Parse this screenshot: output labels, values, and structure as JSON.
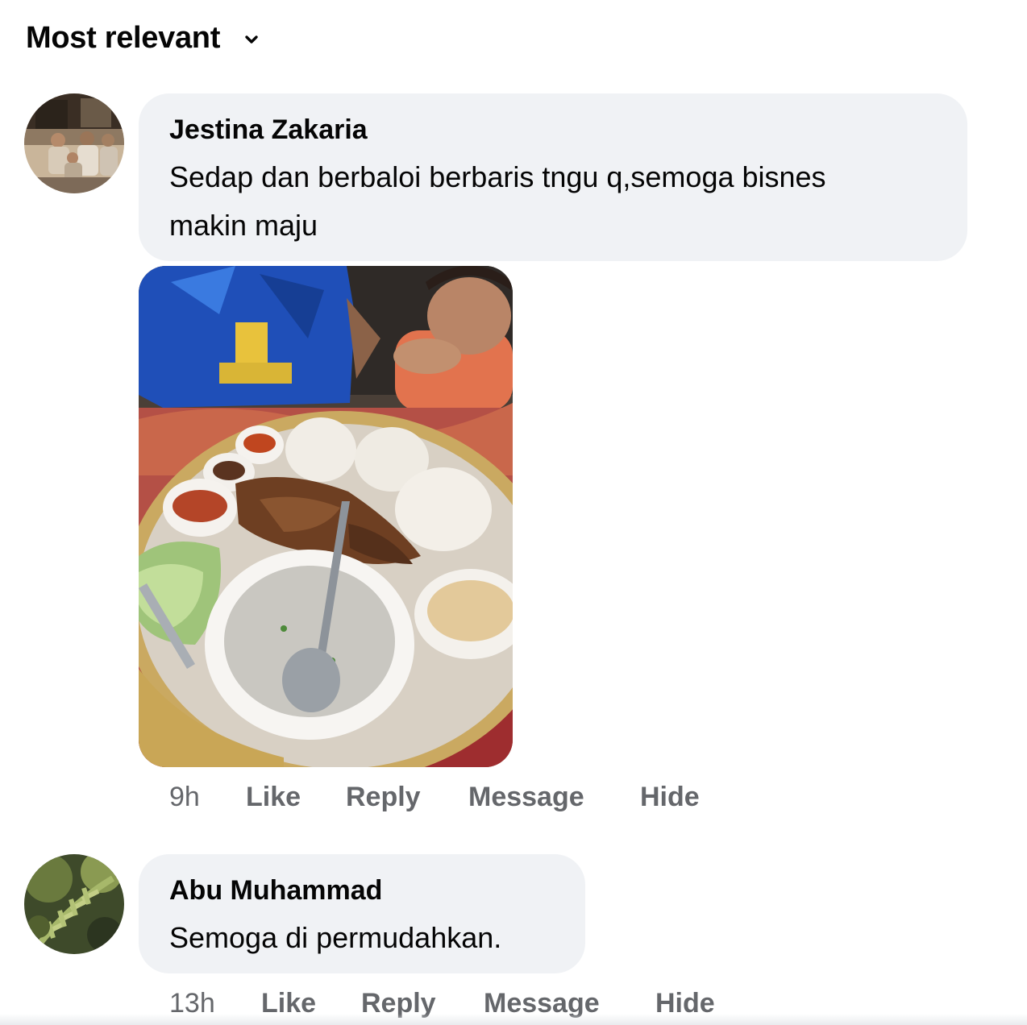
{
  "sort": {
    "label": "Most relevant",
    "icon": "chevron-down-icon"
  },
  "comments": [
    {
      "author": "Jestina Zakaria",
      "text_lines": [
        "Sedap dan berbaloi berbaris tngu q,semoga bisnes",
        "makin maju"
      ],
      "has_photo": true,
      "time": "9h",
      "actions": [
        "Like",
        "Reply",
        "Message",
        "Hide"
      ]
    },
    {
      "author": "Abu Muhammad",
      "text_lines": [
        "Semoga di permudahkan."
      ],
      "has_photo": false,
      "time": "13h",
      "actions": [
        "Like",
        "Reply",
        "Message",
        "Hide"
      ]
    }
  ],
  "colors": {
    "bubble": "#f0f2f5",
    "meta_text": "#65676b",
    "text": "#050505"
  }
}
